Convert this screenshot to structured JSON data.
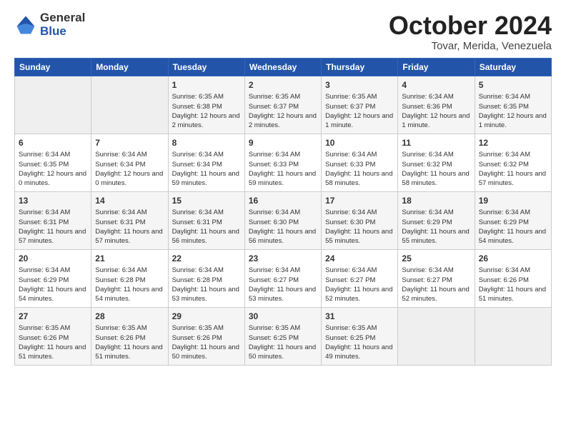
{
  "header": {
    "logo_general": "General",
    "logo_blue": "Blue",
    "month_title": "October 2024",
    "subtitle": "Tovar, Merida, Venezuela"
  },
  "columns": [
    "Sunday",
    "Monday",
    "Tuesday",
    "Wednesday",
    "Thursday",
    "Friday",
    "Saturday"
  ],
  "weeks": [
    [
      {
        "day": "",
        "info": ""
      },
      {
        "day": "",
        "info": ""
      },
      {
        "day": "1",
        "info": "Sunrise: 6:35 AM\nSunset: 6:38 PM\nDaylight: 12 hours and 2 minutes."
      },
      {
        "day": "2",
        "info": "Sunrise: 6:35 AM\nSunset: 6:37 PM\nDaylight: 12 hours and 2 minutes."
      },
      {
        "day": "3",
        "info": "Sunrise: 6:35 AM\nSunset: 6:37 PM\nDaylight: 12 hours and 1 minute."
      },
      {
        "day": "4",
        "info": "Sunrise: 6:34 AM\nSunset: 6:36 PM\nDaylight: 12 hours and 1 minute."
      },
      {
        "day": "5",
        "info": "Sunrise: 6:34 AM\nSunset: 6:35 PM\nDaylight: 12 hours and 1 minute."
      }
    ],
    [
      {
        "day": "6",
        "info": "Sunrise: 6:34 AM\nSunset: 6:35 PM\nDaylight: 12 hours and 0 minutes."
      },
      {
        "day": "7",
        "info": "Sunrise: 6:34 AM\nSunset: 6:34 PM\nDaylight: 12 hours and 0 minutes."
      },
      {
        "day": "8",
        "info": "Sunrise: 6:34 AM\nSunset: 6:34 PM\nDaylight: 11 hours and 59 minutes."
      },
      {
        "day": "9",
        "info": "Sunrise: 6:34 AM\nSunset: 6:33 PM\nDaylight: 11 hours and 59 minutes."
      },
      {
        "day": "10",
        "info": "Sunrise: 6:34 AM\nSunset: 6:33 PM\nDaylight: 11 hours and 58 minutes."
      },
      {
        "day": "11",
        "info": "Sunrise: 6:34 AM\nSunset: 6:32 PM\nDaylight: 11 hours and 58 minutes."
      },
      {
        "day": "12",
        "info": "Sunrise: 6:34 AM\nSunset: 6:32 PM\nDaylight: 11 hours and 57 minutes."
      }
    ],
    [
      {
        "day": "13",
        "info": "Sunrise: 6:34 AM\nSunset: 6:31 PM\nDaylight: 11 hours and 57 minutes."
      },
      {
        "day": "14",
        "info": "Sunrise: 6:34 AM\nSunset: 6:31 PM\nDaylight: 11 hours and 57 minutes."
      },
      {
        "day": "15",
        "info": "Sunrise: 6:34 AM\nSunset: 6:31 PM\nDaylight: 11 hours and 56 minutes."
      },
      {
        "day": "16",
        "info": "Sunrise: 6:34 AM\nSunset: 6:30 PM\nDaylight: 11 hours and 56 minutes."
      },
      {
        "day": "17",
        "info": "Sunrise: 6:34 AM\nSunset: 6:30 PM\nDaylight: 11 hours and 55 minutes."
      },
      {
        "day": "18",
        "info": "Sunrise: 6:34 AM\nSunset: 6:29 PM\nDaylight: 11 hours and 55 minutes."
      },
      {
        "day": "19",
        "info": "Sunrise: 6:34 AM\nSunset: 6:29 PM\nDaylight: 11 hours and 54 minutes."
      }
    ],
    [
      {
        "day": "20",
        "info": "Sunrise: 6:34 AM\nSunset: 6:29 PM\nDaylight: 11 hours and 54 minutes."
      },
      {
        "day": "21",
        "info": "Sunrise: 6:34 AM\nSunset: 6:28 PM\nDaylight: 11 hours and 54 minutes."
      },
      {
        "day": "22",
        "info": "Sunrise: 6:34 AM\nSunset: 6:28 PM\nDaylight: 11 hours and 53 minutes."
      },
      {
        "day": "23",
        "info": "Sunrise: 6:34 AM\nSunset: 6:27 PM\nDaylight: 11 hours and 53 minutes."
      },
      {
        "day": "24",
        "info": "Sunrise: 6:34 AM\nSunset: 6:27 PM\nDaylight: 11 hours and 52 minutes."
      },
      {
        "day": "25",
        "info": "Sunrise: 6:34 AM\nSunset: 6:27 PM\nDaylight: 11 hours and 52 minutes."
      },
      {
        "day": "26",
        "info": "Sunrise: 6:34 AM\nSunset: 6:26 PM\nDaylight: 11 hours and 51 minutes."
      }
    ],
    [
      {
        "day": "27",
        "info": "Sunrise: 6:35 AM\nSunset: 6:26 PM\nDaylight: 11 hours and 51 minutes."
      },
      {
        "day": "28",
        "info": "Sunrise: 6:35 AM\nSunset: 6:26 PM\nDaylight: 11 hours and 51 minutes."
      },
      {
        "day": "29",
        "info": "Sunrise: 6:35 AM\nSunset: 6:26 PM\nDaylight: 11 hours and 50 minutes."
      },
      {
        "day": "30",
        "info": "Sunrise: 6:35 AM\nSunset: 6:25 PM\nDaylight: 11 hours and 50 minutes."
      },
      {
        "day": "31",
        "info": "Sunrise: 6:35 AM\nSunset: 6:25 PM\nDaylight: 11 hours and 49 minutes."
      },
      {
        "day": "",
        "info": ""
      },
      {
        "day": "",
        "info": ""
      }
    ]
  ]
}
